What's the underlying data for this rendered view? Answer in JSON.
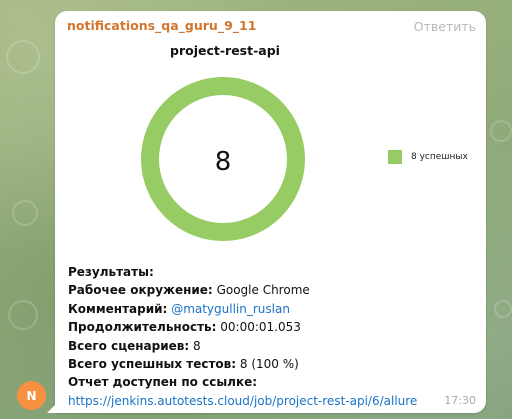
{
  "message": {
    "sender": "notifications_qa_guru_9_11",
    "reply_label": "Ответить",
    "time": "17:30"
  },
  "avatar": {
    "initial": "N",
    "color": "#f7913f"
  },
  "chart_data": {
    "type": "pie",
    "style": "donut",
    "title": "project-rest-api",
    "center_label": "8",
    "slices": [
      {
        "name": "8 успешных",
        "value": 8,
        "color": "#97cc64"
      }
    ],
    "legend_position": "right"
  },
  "results": {
    "heading": "Результаты:",
    "environment_label": "Рабочее окружение:",
    "environment_value": "Google Chrome",
    "comment_label": "Комментарий:",
    "comment_value": "@matygullin_ruslan",
    "duration_label": "Продолжительность:",
    "duration_value": "00:00:01.053",
    "scenarios_label": "Всего сценариев:",
    "scenarios_value": "8",
    "passed_label": "Всего успешных тестов:",
    "passed_value": "8 (100 %)",
    "report_label": "Отчет доступен по ссылке:",
    "report_link": "https://jenkins.autotests.cloud/job/project-rest-api/6/allure"
  },
  "colors": {
    "sender": "#d2752e",
    "link": "#1a73c8",
    "bubble": "#ffffff",
    "chat_background": "#93a97c"
  }
}
